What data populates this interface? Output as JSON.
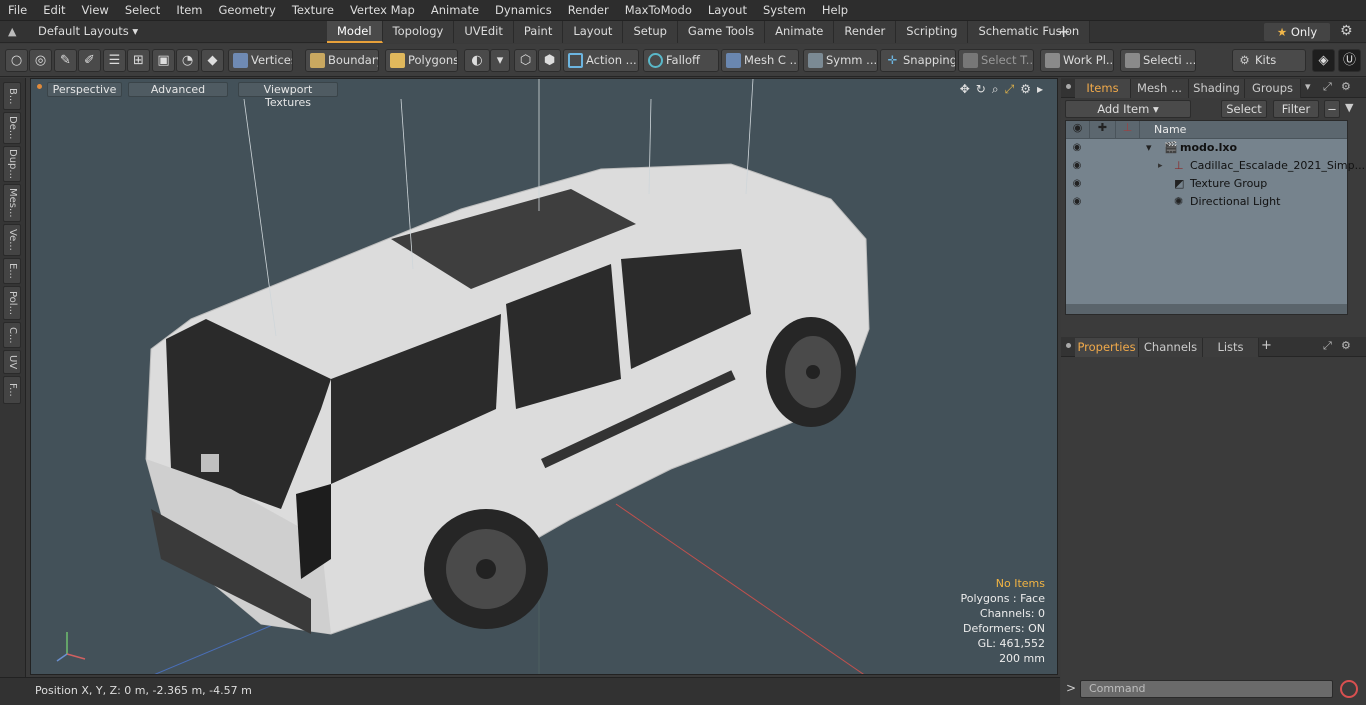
{
  "menu": [
    "File",
    "Edit",
    "View",
    "Select",
    "Item",
    "Geometry",
    "Texture",
    "Vertex Map",
    "Animate",
    "Dynamics",
    "Render",
    "MaxToModo",
    "Layout",
    "System",
    "Help"
  ],
  "layouts_label": "Default Layouts",
  "tabs": [
    "Model",
    "Topology",
    "UVEdit",
    "Paint",
    "Layout",
    "Setup",
    "Game Tools",
    "Animate",
    "Render",
    "Scripting",
    "Schematic Fusion"
  ],
  "active_tab": "Model",
  "only_label": "Only",
  "toolbar": {
    "vertices": "Vertices",
    "boundary": "Boundary",
    "polygons": "Polygons",
    "action": "Action ...",
    "falloff": "Falloff",
    "mesh": "Mesh C ...",
    "symm": "Symm ...",
    "snapping": "Snapping",
    "select_t": "Select T...",
    "work_plane": "Work Pl...",
    "selection": "Selecti ...",
    "kits": "Kits"
  },
  "left_tabs": [
    "B...",
    "De...",
    "Dup...",
    "Mes...",
    "Ve...",
    "E...",
    "Pol...",
    "C...",
    "UV",
    "F..."
  ],
  "viewport": {
    "perspective": "Perspective",
    "advanced": "Advanced",
    "textures": "Viewport Textures",
    "stats": {
      "no_items": "No Items",
      "polygons": "Polygons : Face",
      "channels": "Channels: 0",
      "deformers": "Deformers: ON",
      "gl": "GL: 461,552",
      "scale": "200 mm"
    }
  },
  "status": {
    "position": "Position X, Y, Z:   0 m, -2.365 m, -4.57 m"
  },
  "items_panel": {
    "tabs": [
      "Items",
      "Mesh ...",
      "Shading",
      "Groups"
    ],
    "add_item": "Add Item",
    "select": "Select",
    "filter": "Filter",
    "name_col": "Name",
    "rows": [
      {
        "label": "modo.lxo"
      },
      {
        "label": "Cadillac_Escalade_2021_Simp..."
      },
      {
        "label": "Texture Group"
      },
      {
        "label": "Directional Light"
      }
    ]
  },
  "properties_panel": {
    "tabs": [
      "Properties",
      "Channels",
      "Lists"
    ]
  },
  "command": {
    "placeholder": "Command"
  },
  "colors": {
    "accent": "#e8a13a",
    "viewport_bg": "#435159",
    "tree_bg": "#76838d"
  }
}
